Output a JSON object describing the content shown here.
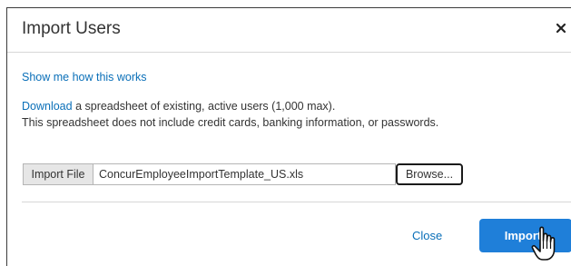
{
  "dialog": {
    "title": "Import Users",
    "close_glyph": "×",
    "help_link": "Show me how this works",
    "description": {
      "download_link": "Download",
      "line1_rest": " a spreadsheet of existing, active users (1,000 max).",
      "line2": "This spreadsheet does not include credit cards, banking information, or passwords."
    },
    "file": {
      "label": "Import File",
      "value": "ConcurEmployeeImportTemplate_US.xls",
      "browse_label": "Browse..."
    },
    "footer": {
      "close_label": "Close",
      "import_label": "Import"
    }
  },
  "icons": {
    "close": "close-icon",
    "cursor": "hand-pointer-icon"
  },
  "colors": {
    "link": "#0a6fb8",
    "primary_button": "#1f7fd9",
    "text": "#333333"
  }
}
